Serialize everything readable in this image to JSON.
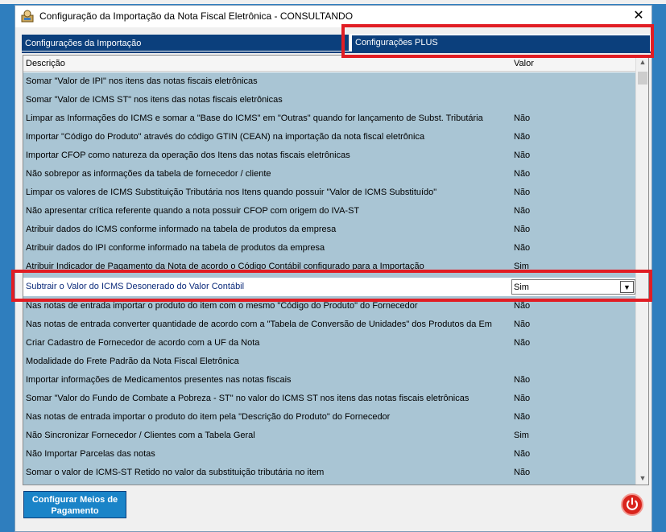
{
  "window": {
    "title": "Configuração da Importação da Nota Fiscal Eletrônica   -   CONSULTANDO",
    "close_glyph": "✕"
  },
  "tabs": [
    {
      "label": "Configurações da Importação"
    },
    {
      "label": "Configurações PLUS"
    }
  ],
  "grid": {
    "headers": {
      "description": "Descrição",
      "value": "Valor"
    },
    "rows": [
      {
        "desc": "Somar \"Valor de IPI\" nos itens das notas fiscais eletrônicas",
        "val": ""
      },
      {
        "desc": "Somar \"Valor de ICMS ST\" nos itens das notas fiscais eletrônicas",
        "val": ""
      },
      {
        "desc": "Limpar as Informações do ICMS e somar a \"Base do ICMS\" em \"Outras\" quando for lançamento de Subst. Tributária",
        "val": "Não"
      },
      {
        "desc": "Importar \"Código do Produto\" através do código GTIN (CEAN) na importação da nota fiscal eletrônica",
        "val": "Não"
      },
      {
        "desc": "Importar CFOP como natureza da operação dos Itens das notas fiscais eletrônicas",
        "val": "Não"
      },
      {
        "desc": "Não sobrepor as informações da tabela de fornecedor / cliente",
        "val": "Não"
      },
      {
        "desc": "Limpar os valores de ICMS Substituição Tributária nos Itens quando possuir \"Valor de ICMS Substituído\"",
        "val": "Não"
      },
      {
        "desc": "Não apresentar crítica referente quando a nota possuir CFOP com origem do IVA-ST",
        "val": "Não"
      },
      {
        "desc": "Atribuir dados do ICMS conforme informado na tabela de produtos da empresa",
        "val": "Não"
      },
      {
        "desc": "Atribuir dados do IPI conforme informado na tabela de produtos da empresa",
        "val": "Não"
      },
      {
        "desc": "Atribuir Indicador de Pagamento da Nota de acordo o Código Contábil configurado para a Importação",
        "val": "Sim"
      },
      {
        "desc": "Subtrair o Valor do ICMS Desonerado do Valor Contábil",
        "val": "Sim"
      },
      {
        "desc": "Nas notas de entrada importar o produto do item com o mesmo \"Código do Produto\" do Fornecedor",
        "val": "Não"
      },
      {
        "desc": "Nas notas de entrada converter quantidade de acordo com a \"Tabela de Conversão de Unidades\" dos Produtos da Em",
        "val": "Não"
      },
      {
        "desc": "Criar Cadastro de Fornecedor de acordo com a UF da Nota",
        "val": "Não"
      },
      {
        "desc": "Modalidade do Frete Padrão da Nota Fiscal Eletrônica",
        "val": ""
      },
      {
        "desc": "Importar informações de Medicamentos presentes nas notas fiscais",
        "val": "Não"
      },
      {
        "desc": "Somar \"Valor do Fundo de Combate a Pobreza - ST\" no valor do ICMS ST nos itens das notas fiscais eletrônicas",
        "val": "Não"
      },
      {
        "desc": "Nas notas de entrada importar o produto do item pela \"Descrição do Produto\" do Fornecedor",
        "val": "Não"
      },
      {
        "desc": "Não Sincronizar Fornecedor / Clientes com a Tabela Geral",
        "val": "Sim"
      },
      {
        "desc": "Não Importar Parcelas das notas",
        "val": "Não"
      },
      {
        "desc": "Somar o valor de ICMS-ST Retido no valor da substituição tributária no item",
        "val": "Não"
      }
    ],
    "selected_index": 11
  },
  "footer": {
    "payment_button_line1": "Configurar Meios de",
    "payment_button_line2": "Pagamento"
  },
  "icons": {
    "app_icon": "app-icon",
    "close": "close-icon",
    "dropdown": "chevron-down-icon",
    "power": "power-icon",
    "scroll_up": "scroll-up-icon",
    "scroll_down": "scroll-down-icon"
  },
  "colors": {
    "tab_bg": "#0b3f7c",
    "row_bg": "#a9c5d4",
    "desktop_bg": "#2f7ebe",
    "highlight": "#e11d24",
    "power": "#d9241c",
    "button": "#1a84c8"
  }
}
